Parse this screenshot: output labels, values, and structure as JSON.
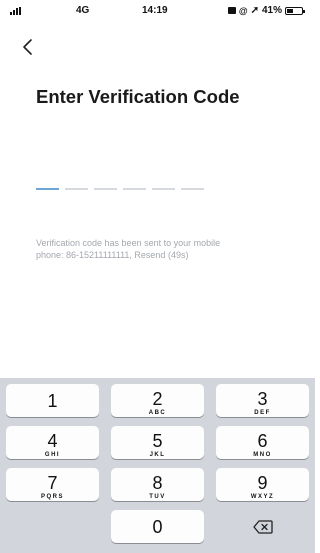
{
  "status_bar": {
    "network": "4G",
    "time": "14:19",
    "battery_text": "41%",
    "battery_level": 0.41
  },
  "nav": {
    "back_icon": "chevron-left-icon"
  },
  "page": {
    "title": "Enter Verification Code"
  },
  "code_input": {
    "slot_count": 6,
    "active_slot": 1
  },
  "message": {
    "line1": "Verification code has been sent to your mobile",
    "line2": "phone: 86-15211111111, Resend (49s)"
  },
  "keypad": {
    "keys": [
      {
        "number": "1",
        "letters": ""
      },
      {
        "number": "2",
        "letters": "ABC"
      },
      {
        "number": "3",
        "letters": "DEF"
      },
      {
        "number": "4",
        "letters": "GHI"
      },
      {
        "number": "5",
        "letters": "JKL"
      },
      {
        "number": "6",
        "letters": "MNO"
      },
      {
        "number": "7",
        "letters": "PQRS"
      },
      {
        "number": "8",
        "letters": "TUV"
      },
      {
        "number": "9",
        "letters": "WXYZ"
      },
      {
        "number": "0",
        "letters": ""
      }
    ],
    "delete_icon": "backspace-icon"
  }
}
